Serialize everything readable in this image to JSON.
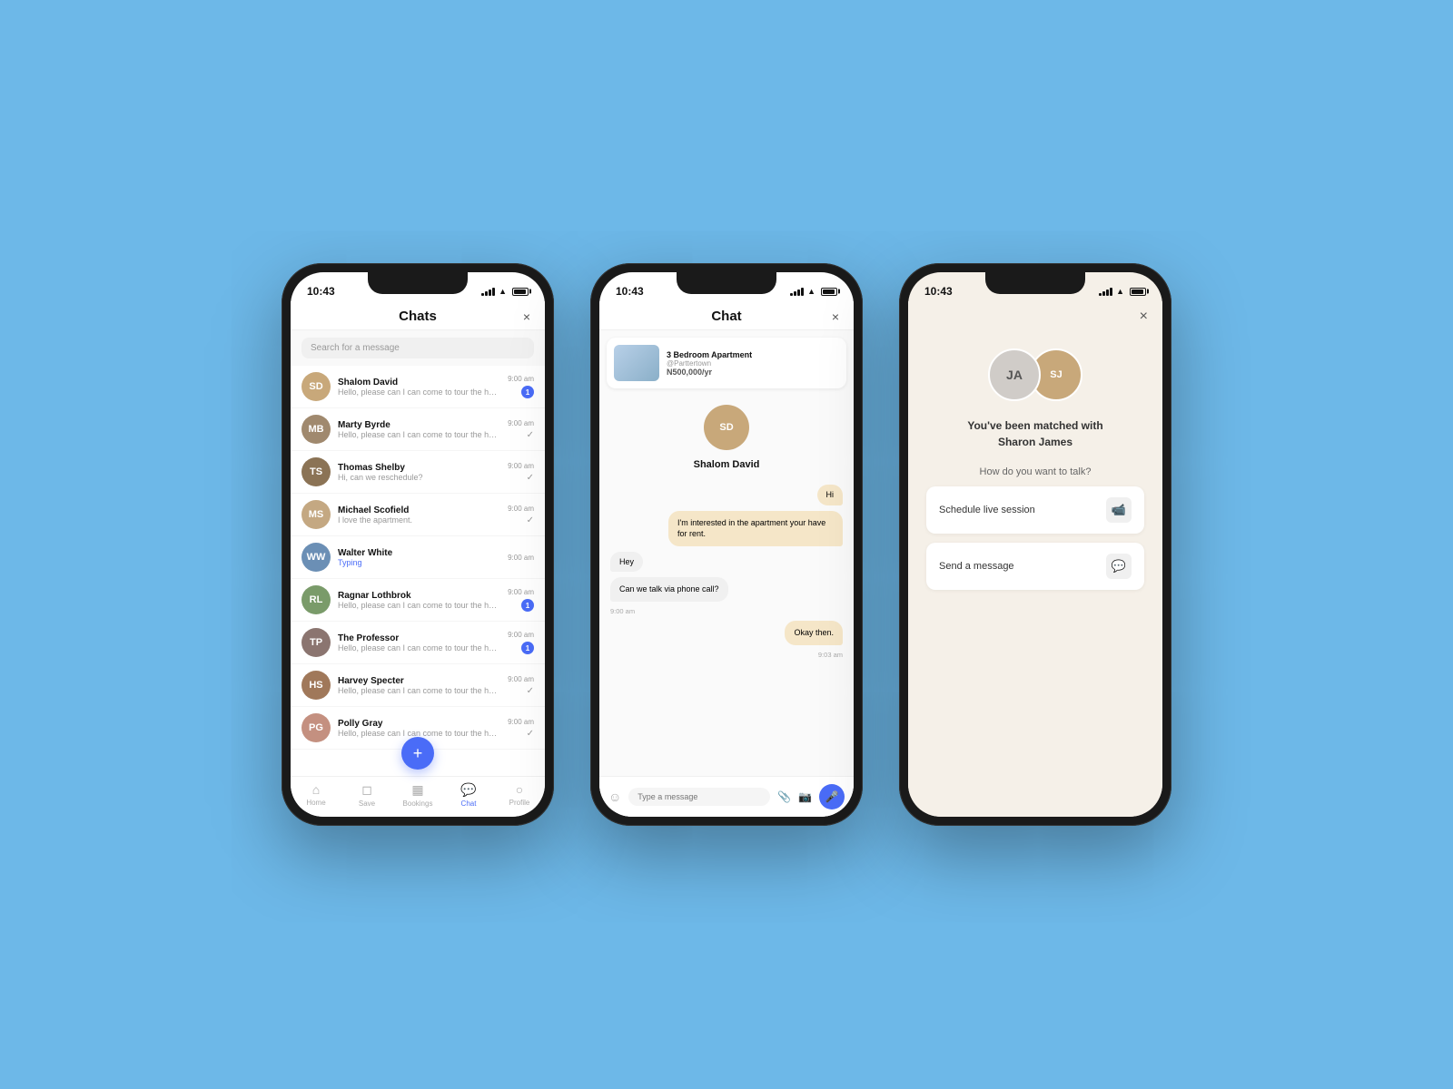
{
  "background": "#6db8e8",
  "phones": [
    {
      "id": "phone1",
      "type": "chats",
      "status": {
        "time": "10:43",
        "signal": true,
        "wifi": true,
        "battery": true
      },
      "header": {
        "title": "Chats",
        "close_label": "×"
      },
      "search": {
        "placeholder": "Search for a message"
      },
      "chats": [
        {
          "name": "Shalom David",
          "preview": "Hello, please can I can come to tour the house today?",
          "time": "9:00 am",
          "badge": true,
          "initials": "SD",
          "color": "#c8a87a"
        },
        {
          "name": "Marty Byrde",
          "preview": "Hello, please can I can come to tour the house today?",
          "time": "9:00 am",
          "check": true,
          "initials": "MB",
          "color": "#a0896e"
        },
        {
          "name": "Thomas Shelby",
          "preview": "Hi, can we reschedule?",
          "time": "9:00 am",
          "check": true,
          "initials": "TS",
          "color": "#8b7355"
        },
        {
          "name": "Michael Scofield",
          "preview": "I love the apartment.",
          "time": "9:00 am",
          "check": true,
          "initials": "MS",
          "color": "#c4a882"
        },
        {
          "name": "Walter White",
          "preview": "Typing",
          "typing": true,
          "time": "9:00 am",
          "initials": "WW",
          "color": "#6b8fb5"
        },
        {
          "name": "Ragnar Lothbrok",
          "preview": "Hello, please can I can come to tour the house today?",
          "time": "9:00 am",
          "badge": true,
          "initials": "RL",
          "color": "#7a9b6a"
        },
        {
          "name": "The Professor",
          "preview": "Hello, please can I can come to tour the house today?",
          "time": "9:00 am",
          "badge": true,
          "initials": "TP",
          "color": "#8b7570"
        },
        {
          "name": "Harvey Specter",
          "preview": "Hello, please can I can come to tour the house today?",
          "time": "9:00 am",
          "check": true,
          "initials": "HS",
          "color": "#a0785a"
        },
        {
          "name": "Polly Gray",
          "preview": "Hello, please can I can come to tour the house today?",
          "time": "9:00 am",
          "check": true,
          "initials": "PG",
          "color": "#c49080"
        }
      ],
      "fab": "+",
      "nav": [
        {
          "label": "Home",
          "icon": "⌂",
          "active": false
        },
        {
          "label": "Save",
          "icon": "🔖",
          "active": false
        },
        {
          "label": "Bookings",
          "icon": "📋",
          "active": false
        },
        {
          "label": "Chat",
          "icon": "💬",
          "active": true
        },
        {
          "label": "Profile",
          "icon": "👤",
          "active": false
        }
      ]
    },
    {
      "id": "phone2",
      "type": "chat",
      "status": {
        "time": "10:43",
        "signal": true,
        "wifi": true,
        "battery": true
      },
      "header": {
        "title": "Chat",
        "close_label": "×"
      },
      "property": {
        "name": "3 Bedroom Apartment",
        "sub": "@Parttertown",
        "price": "N500,000/yr"
      },
      "contact": {
        "name": "Shalom David",
        "initials": "SD",
        "color": "#c8a87a"
      },
      "messages": [
        {
          "text": "Hi",
          "type": "sent",
          "time": null
        },
        {
          "text": "I'm interested in the apartment your have for rent.",
          "type": "sent",
          "time": null
        },
        {
          "text": "Hey",
          "type": "received",
          "time": null
        },
        {
          "text": "Can we talk via phone call?",
          "type": "received",
          "time": "9:00 am"
        },
        {
          "text": "Okay then.",
          "type": "sent",
          "time": "9:03 am"
        }
      ],
      "input_placeholder": "Type a message"
    },
    {
      "id": "phone3",
      "type": "match",
      "status": {
        "time": "10:43",
        "signal": true,
        "wifi": true,
        "battery": true
      },
      "header": {
        "close_label": "×"
      },
      "match": {
        "user1_initials": "JA",
        "user2_color": "#c8a87a",
        "match_text_line1": "You've been matched with",
        "match_text_line2": "Sharon James",
        "question": "How do you want to talk?",
        "action1_label": "Schedule live session",
        "action2_label": "Send a message"
      }
    }
  ]
}
